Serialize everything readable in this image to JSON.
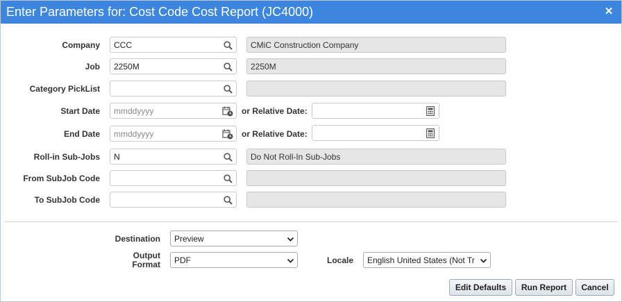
{
  "dialog": {
    "title": "Enter Parameters for: Cost Code Cost Report (JC4000)",
    "close_icon": "close-icon"
  },
  "params": {
    "company": {
      "label": "Company",
      "value": "CCC",
      "description": "CMiC Construction Company"
    },
    "job": {
      "label": "Job",
      "value": "2250M",
      "description": "2250M"
    },
    "category": {
      "label": "Category PickList",
      "value": "",
      "description": ""
    },
    "start_date": {
      "label": "Start Date",
      "placeholder": "mmddyyyy",
      "relative_label": "or Relative Date:",
      "relative_value": ""
    },
    "end_date": {
      "label": "End Date",
      "placeholder": "mmddyyyy",
      "relative_label": "or Relative Date:",
      "relative_value": ""
    },
    "rollin": {
      "label": "Roll-in Sub-Jobs",
      "value": "N",
      "description": "Do Not Roll-In Sub-Jobs"
    },
    "from_subjob": {
      "label": "From SubJob Code",
      "value": "",
      "description": ""
    },
    "to_subjob": {
      "label": "To SubJob Code",
      "value": "",
      "description": ""
    }
  },
  "output": {
    "destination": {
      "label": "Destination",
      "value": "Preview"
    },
    "format": {
      "label_line1": "Output",
      "label_line2": "Format",
      "value": "PDF"
    },
    "locale": {
      "label": "Locale",
      "value": "English United States (Not Translated)"
    }
  },
  "buttons": {
    "edit_defaults": "Edit Defaults",
    "run_report": "Run Report",
    "cancel": "Cancel"
  },
  "colors": {
    "titlebar": "#3d86e0",
    "readonly_bg": "#e6e6e6",
    "icon": "#555555"
  }
}
